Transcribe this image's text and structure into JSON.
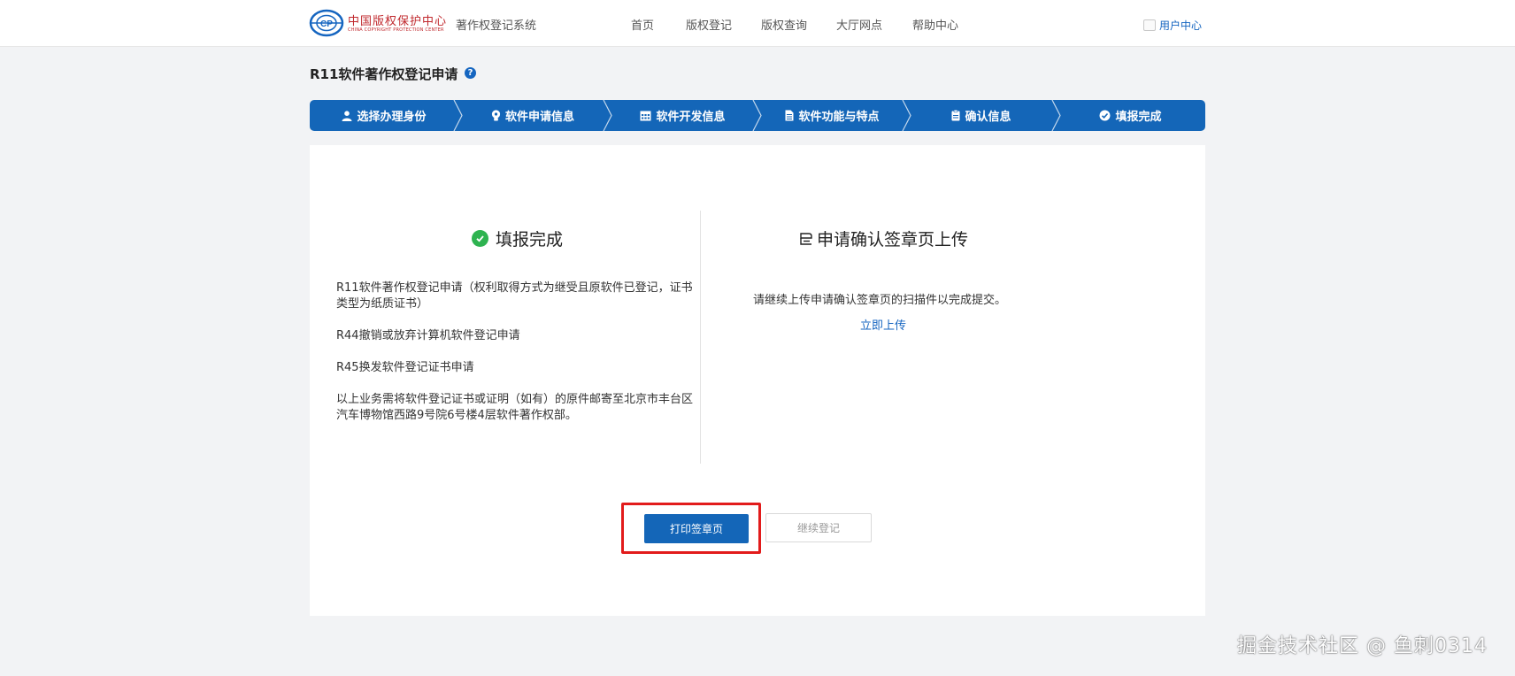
{
  "header": {
    "logo_cn": "中国版权保护中心",
    "logo_en": "CHINA COPYRIGHT PROTECTION CENTER",
    "system_name": "著作权登记系统",
    "nav": [
      "首页",
      "版权登记",
      "版权查询",
      "大厅网点",
      "帮助中心"
    ],
    "user_center": "用户中心"
  },
  "page_title": "R11软件著作权登记申请",
  "help_icon": "?",
  "steps": [
    {
      "label": "选择办理身份",
      "icon": "person-icon"
    },
    {
      "label": "软件申请信息",
      "icon": "lightbulb-icon"
    },
    {
      "label": "软件开发信息",
      "icon": "calendar-icon"
    },
    {
      "label": "软件功能与特点",
      "icon": "document-icon"
    },
    {
      "label": "确认信息",
      "icon": "clipboard-icon"
    },
    {
      "label": "填报完成",
      "icon": "check-circle-icon"
    }
  ],
  "left": {
    "title": "填报完成",
    "items": [
      "R11软件著作权登记申请（权利取得方式为继受且原软件已登记，证书类型为纸质证书）",
      "R44撤销或放弃计算机软件登记申请",
      "R45换发软件登记证书申请",
      "以上业务需将软件登记证书或证明（如有）的原件邮寄至北京市丰台区汽车博物馆西路9号院6号楼4层软件著作权部。"
    ]
  },
  "right": {
    "title": "申请确认签章页上传",
    "description": "请继续上传申请确认签章页的扫描件以完成提交。",
    "upload_link": "立即上传"
  },
  "buttons": {
    "print": "打印签章页",
    "continue": "继续登记"
  },
  "watermark": "掘金技术社区 @ 鱼刺0314",
  "colors": {
    "primary": "#1466b8",
    "success": "#2eb350",
    "highlight": "#e21b1b",
    "logo_red": "#c0282d"
  }
}
